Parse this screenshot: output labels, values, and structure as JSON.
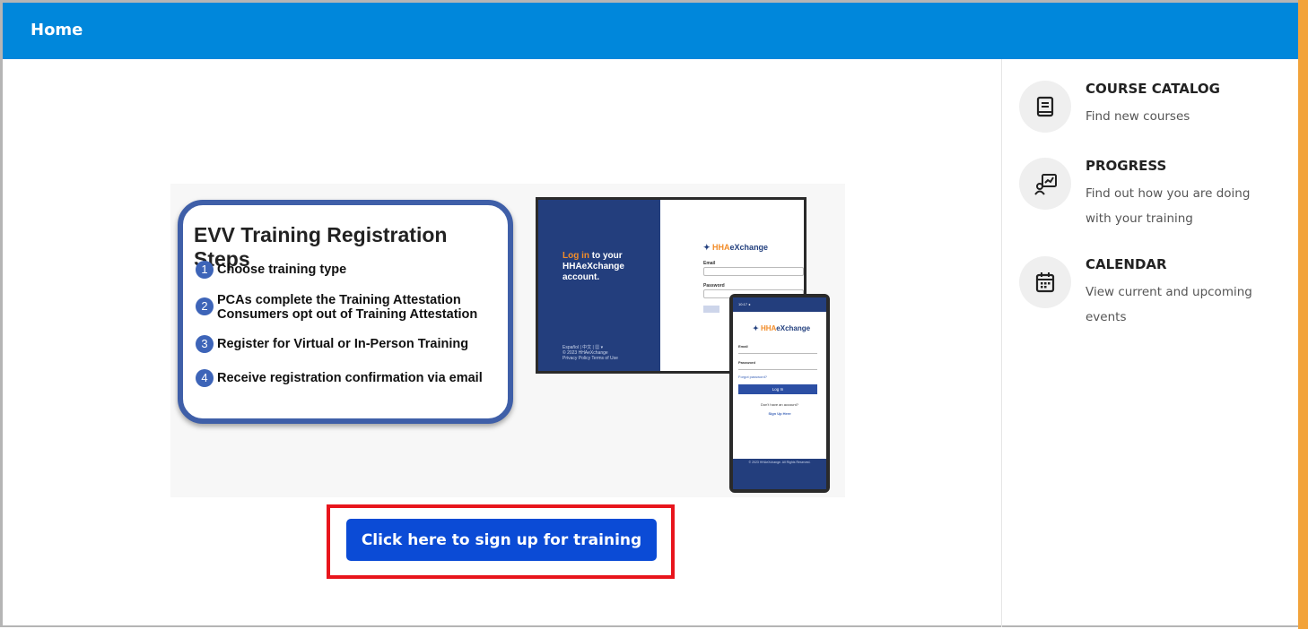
{
  "header": {
    "title": "Home"
  },
  "promo": {
    "title": "EVV Training Registration Steps",
    "steps": [
      {
        "num": "1",
        "text": "Choose training type"
      },
      {
        "num": "2",
        "text": "PCAs complete the Training Attestation Consumers opt out of Training Attestation"
      },
      {
        "num": "3",
        "text": "Register for Virtual or In-Person Training"
      },
      {
        "num": "4",
        "text": "Receive registration confirmation via email"
      }
    ],
    "desktop": {
      "heading_highlight": "Log in",
      "heading_rest": " to your HHAeXchange account.",
      "logo_prefix": "HHA",
      "logo_suffix": "eXchange",
      "email_label": "Email",
      "password_label": "Password",
      "footer_lang": "Español | 中文 | ▦ ▾",
      "footer_copy": "© 2023 HHAeXchange",
      "footer_links": "Privacy Policy   Terms of Use"
    },
    "phone": {
      "status": "10:17 ◂",
      "logo_prefix": "HHA",
      "logo_suffix": "eXchange",
      "email_label": "Email",
      "password_label": "Password",
      "forgot": "Forgot password?",
      "login_btn": "Log In",
      "no_account": "Don't have an account?",
      "sign_up": "Sign Up Here",
      "footer": "© 2023 HHAeXchange. All Rights Reserved."
    }
  },
  "signup_button": {
    "label": "Click here to sign up for training"
  },
  "nav": [
    {
      "title": "COURSE CATALOG",
      "desc": "Find new courses",
      "icon": "book-icon"
    },
    {
      "title": "PROGRESS",
      "desc": "Find out how you are doing with your training",
      "icon": "progress-chart-icon"
    },
    {
      "title": "CALENDAR",
      "desc": "View current and upcoming events",
      "icon": "calendar-icon"
    }
  ],
  "colors": {
    "header": "#0087db",
    "button": "#0b4bd6",
    "highlight_outline": "#e8151c",
    "accent": "#f2a33a"
  }
}
